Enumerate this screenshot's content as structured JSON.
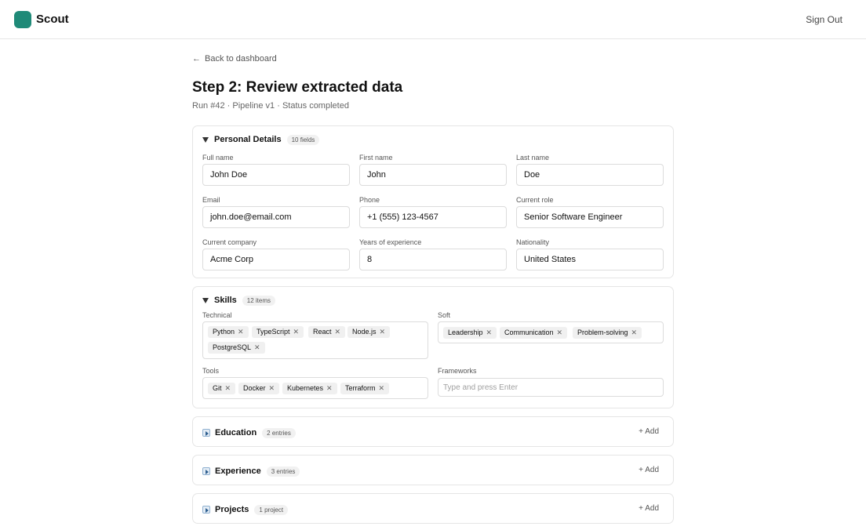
{
  "app": {
    "name": "Scout",
    "brand_color": "#1f8a78",
    "signout_label": "Sign Out"
  },
  "nav": {
    "back_label": "Back to dashboard",
    "back_icon": "arrow-left-icon"
  },
  "page": {
    "title": "Step 2: Review extracted data",
    "subtitle": "Run #42 · Pipeline v1 · Status completed"
  },
  "personal": {
    "title": "Personal Details",
    "badge": "10 fields",
    "fields": [
      {
        "label": "Full name",
        "value": "John Doe"
      },
      {
        "label": "First name",
        "value": "John"
      },
      {
        "label": "Last name",
        "value": "Doe"
      },
      {
        "label": "Email",
        "value": "john.doe@email.com"
      },
      {
        "label": "Phone",
        "value": "+1 (555) 123-4567"
      },
      {
        "label": "Current role",
        "value": "Senior Software Engineer"
      },
      {
        "label": "Current company",
        "value": "Acme Corp"
      },
      {
        "label": "Years of experience",
        "value": "8"
      },
      {
        "label": "Nationality",
        "value": "United States"
      }
    ]
  },
  "skills": {
    "title": "Skills",
    "badge": "12 items",
    "technical": {
      "label": "Technical",
      "tags": [
        "Python",
        "TypeScript",
        "React",
        "Node.js",
        "PostgreSQL"
      ]
    },
    "soft": {
      "label": "Soft",
      "tags": [
        "Leadership",
        "Communication",
        "Problem-solving"
      ]
    },
    "tools": {
      "label": "Tools",
      "tags": [
        "Git",
        "Docker",
        "Kubernetes",
        "Terraform"
      ]
    },
    "frameworks": {
      "label": "Frameworks",
      "placeholder": "Type and press Enter"
    }
  },
  "sections": [
    {
      "title": "Education",
      "badge": "2 entries",
      "add_label": "+ Add"
    },
    {
      "title": "Experience",
      "badge": "3 entries",
      "add_label": "+ Add"
    },
    {
      "title": "Projects",
      "badge": "1 project",
      "add_label": "+ Add"
    }
  ]
}
